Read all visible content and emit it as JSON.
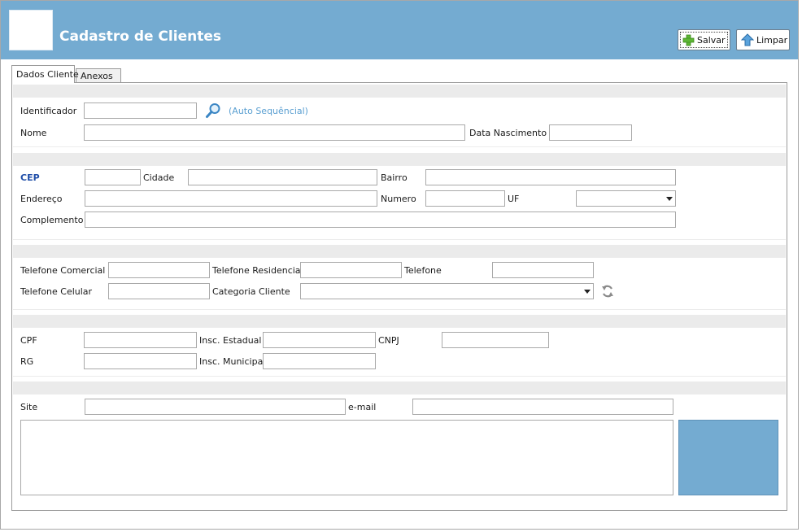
{
  "header": {
    "title": "Cadastro de Clientes",
    "save_label": "Salvar",
    "clear_label": "Limpar"
  },
  "tabs": [
    {
      "label": "Dados Cliente",
      "active": true
    },
    {
      "label": "Anexos",
      "active": false
    }
  ],
  "identification": {
    "id_label": "Identificador",
    "id_value": "",
    "auto_hint": "(Auto Sequêncial)",
    "name_label": "Nome",
    "name_value": "",
    "birth_label": "Data Nascimento",
    "birth_value": ""
  },
  "address": {
    "cep_label": "CEP",
    "city_label": "Cidade",
    "district_label": "Bairro",
    "street_label": "Endereço",
    "number_label": "Numero",
    "uf_label": "UF",
    "uf_value": "",
    "complement_label": "Complemento"
  },
  "phones": {
    "commercial_label": "Telefone Comercial",
    "residential_label": "Telefone Residencial",
    "phone_label": "Telefone",
    "mobile_label": "Telefone Celular",
    "category_label": "Categoria Cliente",
    "category_value": ""
  },
  "documents": {
    "cpf_label": "CPF",
    "state_reg_label": "Insc. Estadual",
    "cnpj_label": "CNPJ",
    "rg_label": "RG",
    "city_reg_label": "Insc. Municipal"
  },
  "web": {
    "site_label": "Site",
    "email_label": "e-mail",
    "notes_value": ""
  },
  "colors": {
    "header_bg": "#74abd1",
    "cep_label": "#1f4ea8",
    "hint": "#5a9fd1",
    "photo_bg": "#74abd1"
  },
  "icons": {
    "save": "plus-icon",
    "clear": "up-arrow-icon",
    "search": "magnifier-icon",
    "refresh": "refresh-icon"
  }
}
